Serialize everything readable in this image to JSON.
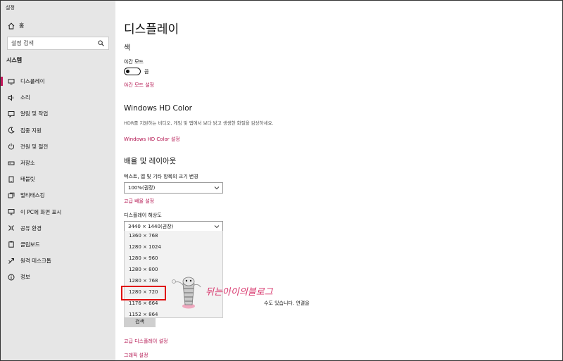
{
  "app": {
    "title": "설정"
  },
  "sidebar": {
    "home_label": "홈",
    "search_placeholder": "설정 검색",
    "section_label": "시스템",
    "items": [
      {
        "label": "디스플레이",
        "icon": "monitor-icon",
        "active": true
      },
      {
        "label": "소리",
        "icon": "speaker-icon"
      },
      {
        "label": "알림 및 작업",
        "icon": "notification-icon"
      },
      {
        "label": "집중 지원",
        "icon": "moon-icon"
      },
      {
        "label": "전원 및 절전",
        "icon": "power-icon"
      },
      {
        "label": "저장소",
        "icon": "storage-icon"
      },
      {
        "label": "태블릿",
        "icon": "tablet-icon"
      },
      {
        "label": "멀티태스킹",
        "icon": "multitasking-icon"
      },
      {
        "label": "이 PC에 화면 표시",
        "icon": "project-icon"
      },
      {
        "label": "공유 환경",
        "icon": "share-icon"
      },
      {
        "label": "클립보드",
        "icon": "clipboard-icon"
      },
      {
        "label": "원격 데스크톱",
        "icon": "remote-desktop-icon"
      },
      {
        "label": "정보",
        "icon": "info-icon"
      }
    ]
  },
  "main": {
    "title": "디스플레이",
    "color": {
      "heading": "색",
      "night_light_label": "야간 모드",
      "night_light_state": "끔",
      "night_light_on": false,
      "night_light_settings_link": "야간 모드 설정"
    },
    "hdr": {
      "heading": "Windows HD Color",
      "description": "HDR를 지원하는 비디오, 게임 및 앱에서 보다 밝고 생생한 화질을 감상하세요.",
      "link": "Windows HD Color 설정"
    },
    "layout": {
      "heading": "배율 및 레이아웃",
      "scale_label": "텍스트, 앱 및 기타 항목의 크기 변경",
      "scale_value": "100%(권장)",
      "advanced_scaling_link": "고급 배율 설정",
      "resolution_label": "디스플레이 해상도",
      "resolution_value": "3440 × 1440(권장)",
      "resolution_options": [
        "1360 × 768",
        "1280 × 1024",
        "1280 × 960",
        "1280 × 800",
        "1280 × 768",
        "1280 × 720",
        "1176 × 664",
        "1152 × 864"
      ],
      "highlighted_option": "1280 × 720"
    },
    "multiple_displays": {
      "text_fragment_1": "수도 있습니다. 연결을",
      "detect_button": "검색",
      "advanced_display_link": "고급 디스플레이 설정",
      "graphics_link": "그래픽 설정"
    },
    "watermark_text": "뒤는아이의블로그"
  },
  "colors": {
    "accent": "#b3134f",
    "sidebar_bg": "#e6e6e6",
    "highlight_box": "#e01010",
    "watermark": "#d7336a"
  }
}
